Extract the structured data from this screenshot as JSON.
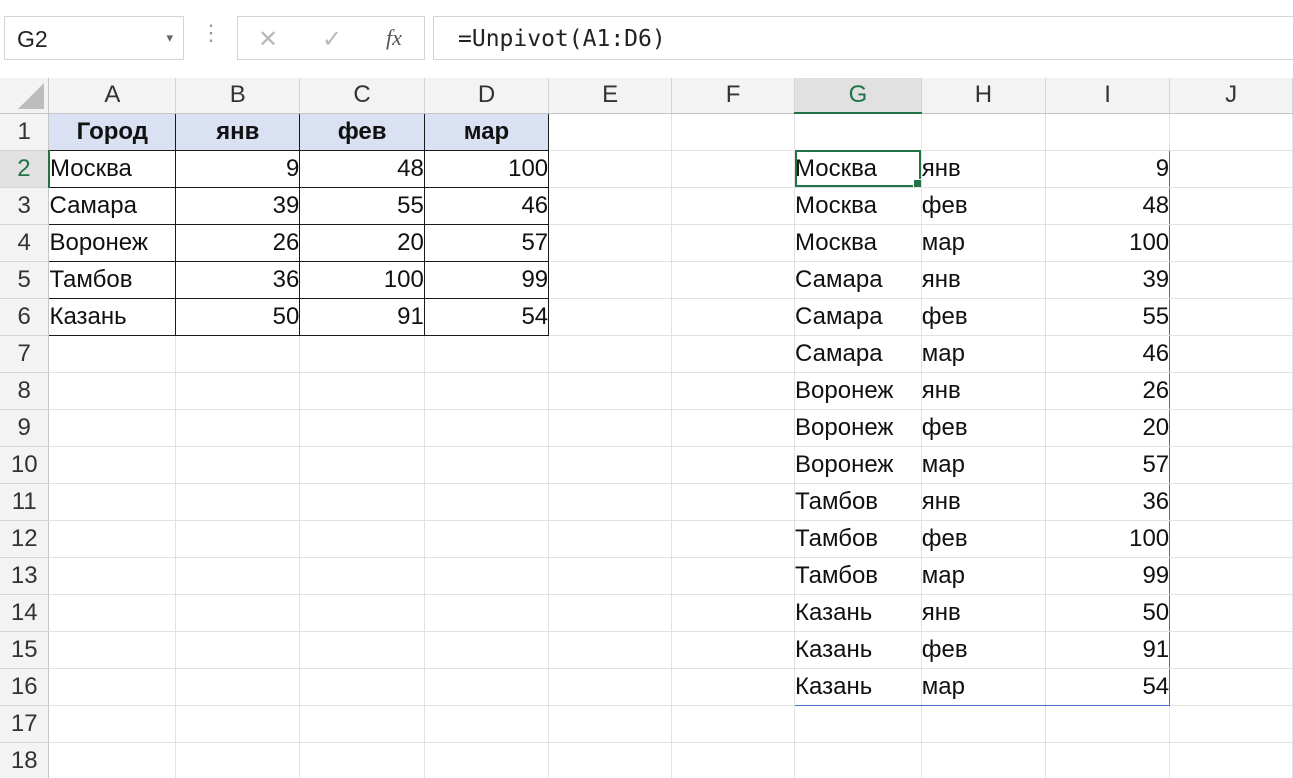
{
  "name_box": {
    "value": "G2",
    "arrow": "▾"
  },
  "formula_bar": {
    "dots": "⋮",
    "cancel_icon": "✕",
    "enter_icon": "✓",
    "fx_label": "fx",
    "formula": "=Unpivot(A1:D6)"
  },
  "columns": [
    "A",
    "B",
    "C",
    "D",
    "E",
    "F",
    "G",
    "H",
    "I",
    "J"
  ],
  "active_column": "G",
  "rows": [
    "1",
    "2",
    "3",
    "4",
    "5",
    "6",
    "7",
    "8",
    "9",
    "10",
    "11",
    "12",
    "13",
    "14",
    "15",
    "16",
    "17",
    "18"
  ],
  "active_row": "2",
  "source_table": {
    "headers": [
      "Город",
      "янв",
      "фев",
      "мар"
    ],
    "rows": [
      [
        "Москва",
        "9",
        "48",
        "100"
      ],
      [
        "Самара",
        "39",
        "55",
        "46"
      ],
      [
        "Воронеж",
        "26",
        "20",
        "57"
      ],
      [
        "Тамбов",
        "36",
        "100",
        "99"
      ],
      [
        "Казань",
        "50",
        "91",
        "54"
      ]
    ]
  },
  "spill_result": [
    [
      "Москва",
      "янв",
      "9"
    ],
    [
      "Москва",
      "фев",
      "48"
    ],
    [
      "Москва",
      "мар",
      "100"
    ],
    [
      "Самара",
      "янв",
      "39"
    ],
    [
      "Самара",
      "фев",
      "55"
    ],
    [
      "Самара",
      "мар",
      "46"
    ],
    [
      "Воронеж",
      "янв",
      "26"
    ],
    [
      "Воронеж",
      "фев",
      "20"
    ],
    [
      "Воронеж",
      "мар",
      "57"
    ],
    [
      "Тамбов",
      "янв",
      "36"
    ],
    [
      "Тамбов",
      "фев",
      "100"
    ],
    [
      "Тамбов",
      "мар",
      "99"
    ],
    [
      "Казань",
      "янв",
      "50"
    ],
    [
      "Казань",
      "фев",
      "91"
    ],
    [
      "Казань",
      "мар",
      "54"
    ]
  ],
  "colors": {
    "header_fill": "#d9e1f2",
    "selection_green": "#217346",
    "spill_border": "#4472c4"
  }
}
